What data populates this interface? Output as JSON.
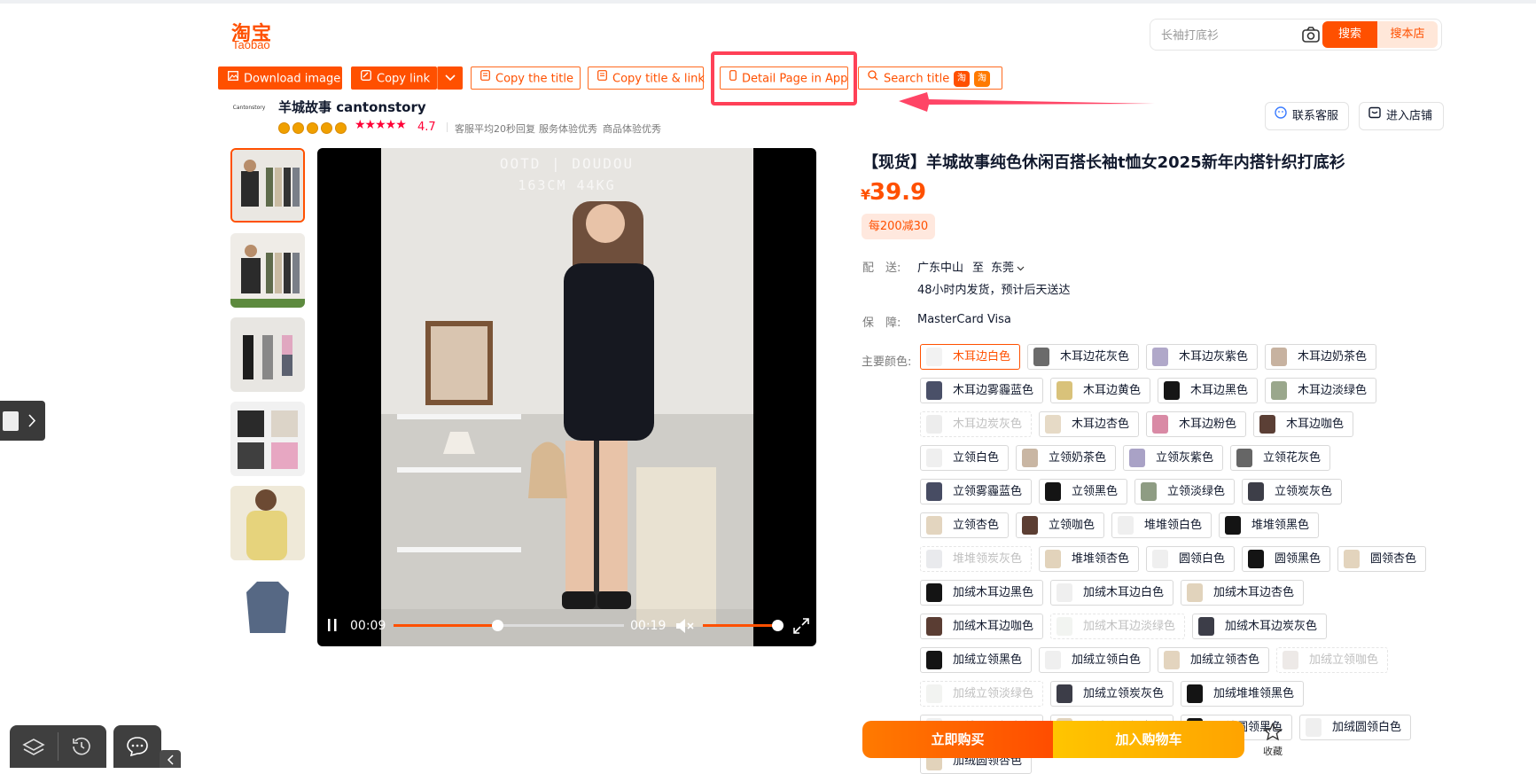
{
  "brand": {
    "logo_cn": "淘宝",
    "logo_en": "Taobao",
    "color": "#ff5000"
  },
  "search": {
    "placeholder": "长袖打底衫",
    "search_label": "搜索",
    "store_label": "搜本店"
  },
  "toolbar": {
    "download_image": "Download image",
    "copy_link": "Copy link",
    "copy_title": "Copy the title",
    "copy_title_link": "Copy title & link",
    "detail_in_app": "Detail Page in App",
    "search_title": "Search title",
    "badge_1": "淘",
    "badge_2": "淘"
  },
  "shop": {
    "logo_text": "Cantonstory",
    "name": "羊城故事 cantonstory",
    "stars": "★★★★★",
    "rating": "4.7",
    "services": [
      "客服平均20秒回复",
      "服务体验优秀",
      "商品体验优秀"
    ],
    "contact": "联系客服",
    "enter_store": "进入店铺"
  },
  "video": {
    "overlay_line1": "OOTD | DOUDOU",
    "overlay_line2": "163CM 44KG",
    "current_time": "00:09",
    "total_time": "00:19",
    "progress": 0.45,
    "volume": 0.95
  },
  "product": {
    "title": "【现货】羊城故事纯色休闲百搭长袖t恤女2025新年内搭针织打底衫",
    "currency": "¥",
    "price": "39.9",
    "promo": "每200减30",
    "shipping_label": "配　送:",
    "ship_from": "广东中山",
    "ship_to_word": "至",
    "ship_to": "东莞",
    "ship_note": "48小时内发货，预计后天送达",
    "guarantee_label": "保　障:",
    "guarantee": "MasterCard Visa",
    "color_label": "主要颜色:"
  },
  "variants": [
    {
      "label": "木耳边白色",
      "swatch": "#f2f2f2",
      "selected": true
    },
    {
      "label": "木耳边花灰色",
      "swatch": "#6b6b6b"
    },
    {
      "label": "木耳边灰紫色",
      "swatch": "#b0a8c9"
    },
    {
      "label": "木耳边奶茶色",
      "swatch": "#c7b2a0"
    },
    {
      "label": "木耳边雾霾蓝色",
      "swatch": "#4a5068"
    },
    {
      "label": "木耳边黄色",
      "swatch": "#d9c27a"
    },
    {
      "label": "木耳边黑色",
      "swatch": "#151515"
    },
    {
      "label": "木耳边淡绿色",
      "swatch": "#9aa78c"
    },
    {
      "label": "木耳边炭灰色",
      "swatch": "#d8d8d8",
      "disabled": true
    },
    {
      "label": "木耳边杏色",
      "swatch": "#e6dac6"
    },
    {
      "label": "木耳边粉色",
      "swatch": "#d98aa5"
    },
    {
      "label": "木耳边咖色",
      "swatch": "#5b3f35"
    },
    {
      "label": "立领白色",
      "swatch": "#efefef"
    },
    {
      "label": "立领奶茶色",
      "swatch": "#c9b6a3"
    },
    {
      "label": "立领灰紫色",
      "swatch": "#a9a2c6"
    },
    {
      "label": "立领花灰色",
      "swatch": "#666"
    },
    {
      "label": "立领雾霾蓝色",
      "swatch": "#474c63"
    },
    {
      "label": "立领黑色",
      "swatch": "#141414"
    },
    {
      "label": "立领淡绿色",
      "swatch": "#8e9c83"
    },
    {
      "label": "立领炭灰色",
      "swatch": "#3d3e48"
    },
    {
      "label": "立领杏色",
      "swatch": "#e3d5bf"
    },
    {
      "label": "立领咖色",
      "swatch": "#5c3e33"
    },
    {
      "label": "堆堆领白色",
      "swatch": "#efefef"
    },
    {
      "label": "堆堆领黑色",
      "swatch": "#141414"
    },
    {
      "label": "堆堆领炭灰色",
      "swatch": "#cfd0d6",
      "disabled": true
    },
    {
      "label": "堆堆领杏色",
      "swatch": "#e2d3bb"
    },
    {
      "label": "圆领白色",
      "swatch": "#efefef"
    },
    {
      "label": "圆领黑色",
      "swatch": "#141414"
    },
    {
      "label": "圆领杏色",
      "swatch": "#e3d4bd"
    },
    {
      "label": "加绒木耳边黑色",
      "swatch": "#141414"
    },
    {
      "label": "加绒木耳边白色",
      "swatch": "#efefef"
    },
    {
      "label": "加绒木耳边杏色",
      "swatch": "#e1d3bc"
    },
    {
      "label": "加绒木耳边咖色",
      "swatch": "#5a3d33"
    },
    {
      "label": "加绒木耳边淡绿色",
      "swatch": "#e3e6df",
      "disabled": true
    },
    {
      "label": "加绒木耳边炭灰色",
      "swatch": "#3c3d48"
    },
    {
      "label": "加绒立领黑色",
      "swatch": "#141414"
    },
    {
      "label": "加绒立领白色",
      "swatch": "#efefef"
    },
    {
      "label": "加绒立领杏色",
      "swatch": "#e3d4be"
    },
    {
      "label": "加绒立领咖色",
      "swatch": "#d7cfc9",
      "disabled": true
    },
    {
      "label": "加绒立领淡绿色",
      "swatch": "#e2e4df",
      "disabled": true
    },
    {
      "label": "加绒立领炭灰色",
      "swatch": "#3c3d48"
    },
    {
      "label": "加绒堆堆领黑色",
      "swatch": "#141414"
    },
    {
      "label": "加绒堆堆领白色",
      "swatch": "#efefef"
    },
    {
      "label": "加绒堆堆领杏色",
      "swatch": "#e2d3bb"
    },
    {
      "label": "加绒圆领黑色",
      "swatch": "#141414"
    },
    {
      "label": "加绒圆领白色",
      "swatch": "#efefef"
    },
    {
      "label": "加绒圆领杏色",
      "swatch": "#e2d3bb"
    }
  ],
  "actions": {
    "buy_now": "立即购买",
    "add_cart": "加入购物车",
    "favorite": "收藏"
  }
}
